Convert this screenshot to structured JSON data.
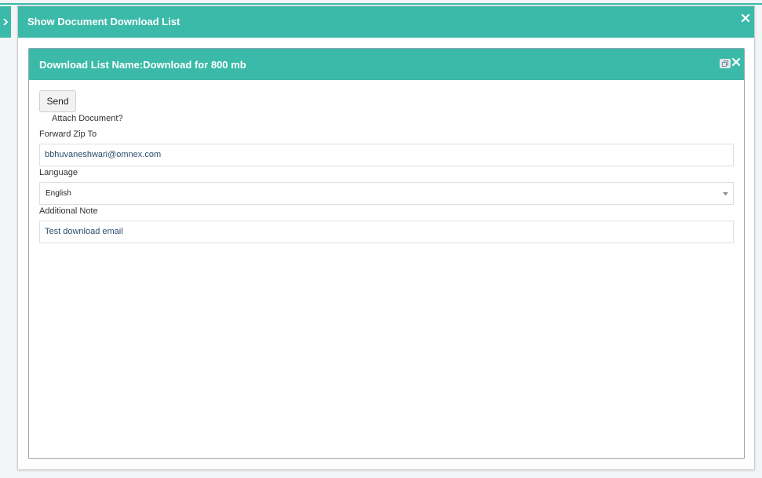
{
  "window": {
    "title": "Show Document Download List",
    "close_icon": "close-icon",
    "side_tab_icon": "chevron-right-icon"
  },
  "panel": {
    "title": "Download List Name:Download for 800 mb",
    "restore_icon": "restore-window-icon",
    "close_icon": "close-icon"
  },
  "form": {
    "send_label": "Send",
    "attach_label": "Attach Document?",
    "forward_label": "Forward Zip To",
    "forward_value": "bbhuvaneshwari@omnex.com",
    "language_label": "Language",
    "language_value": "English",
    "note_label": "Additional Note",
    "note_value": "Test download email"
  },
  "colors": {
    "accent": "#3bbaa9",
    "border": "#9aa6b2",
    "background": "#f3f5f7"
  }
}
